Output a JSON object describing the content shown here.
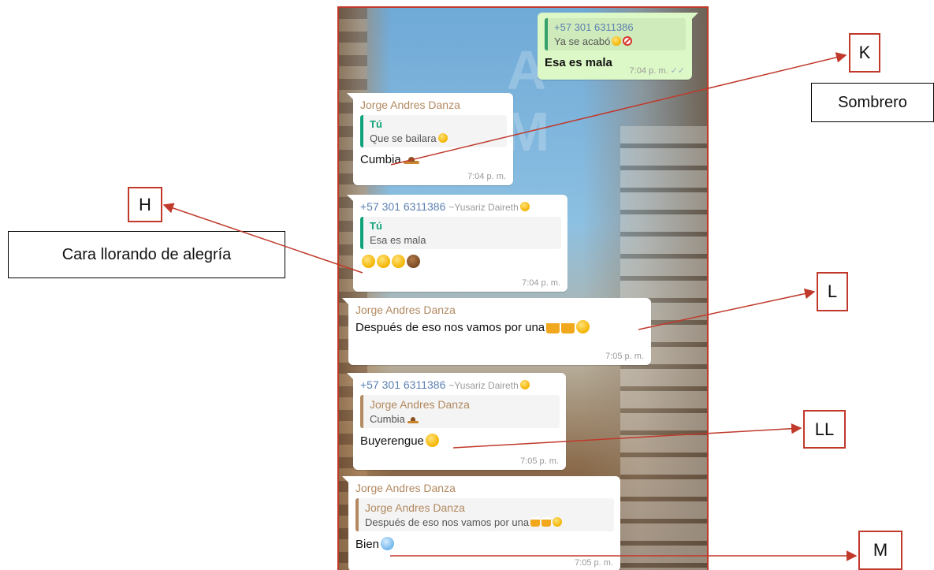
{
  "chat": {
    "watermark": "A M",
    "messages": [
      {
        "sender": "",
        "quote_author": "+57 301 6311386",
        "quote_text": "Ya se acabó",
        "text": "Esa es mala",
        "time": "7:04 p. m.",
        "ticks": "✓✓"
      },
      {
        "sender": "Jorge Andres Danza",
        "quote_author": "Tú",
        "quote_text": "Que se bailara",
        "text": "Cumbia",
        "time": "7:04 p. m."
      },
      {
        "sender": "+57 301 6311386",
        "alias": "~Yusariz Daireth",
        "quote_author": "Tú",
        "quote_text": "Esa es mala",
        "text": "",
        "time": "7:04 p. m."
      },
      {
        "sender": "Jorge Andres Danza",
        "text": "Después de eso nos vamos por una",
        "time": "7:05 p. m."
      },
      {
        "sender": "+57 301 6311386",
        "alias": "~Yusariz Daireth",
        "quote_author": "Jorge Andres Danza",
        "quote_text": "Cumbia",
        "text": "Buyerengue",
        "time": "7:05 p. m."
      },
      {
        "sender": "Jorge Andres Danza",
        "quote_author": "Jorge Andres Danza",
        "quote_text": "Después de eso nos vamos por una",
        "text": "Bien",
        "time": "7:05 p. m."
      }
    ]
  },
  "annotations": {
    "K": "K",
    "sombrero": "Sombrero",
    "H": "H",
    "cara": "Cara llorando de alegría",
    "L": "L",
    "LL": "LL",
    "M": "M"
  },
  "colors": {
    "arrow": "#c0392b",
    "outgoing_bubble": "#dcf8c6",
    "incoming_bubble": "#ffffff",
    "sender_brown": "#b28960",
    "sender_blue": "#5b7fb1",
    "quote_green": "#10a37a"
  }
}
